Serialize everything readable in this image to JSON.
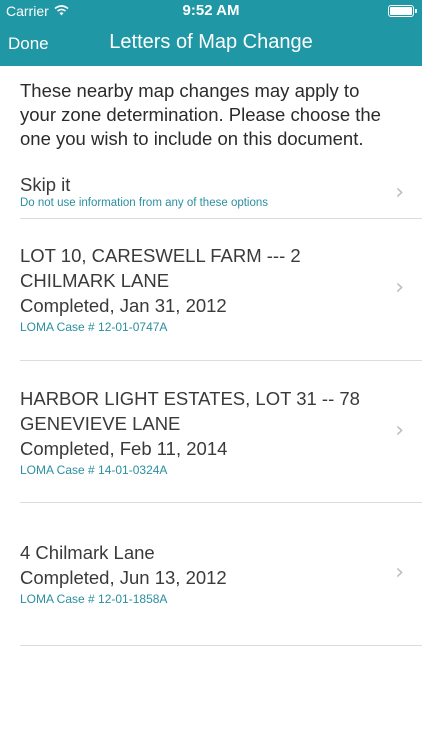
{
  "status_bar": {
    "carrier": "Carrier",
    "time": "9:52 AM",
    "battery_level": 1.0
  },
  "nav": {
    "done_label": "Done",
    "title": "Letters of Map Change"
  },
  "intro_text": "These nearby map changes may apply to your zone determination. Please choose the one you wish to include on this document.",
  "skip": {
    "title": "Skip it",
    "subtitle": "Do not use information from any of these options"
  },
  "items": [
    {
      "title": "LOT 10, CARESWELL FARM --- 2 CHILMARK LANE",
      "status": "Completed, Jan 31, 2012",
      "case": "LOMA Case # 12-01-0747A"
    },
    {
      "title": "HARBOR LIGHT ESTATES, LOT 31 -- 78 GENEVIEVE LANE",
      "status": "Completed, Feb 11, 2014",
      "case": "LOMA Case # 14-01-0324A"
    },
    {
      "title": "4 Chilmark Lane",
      "status": "Completed, Jun 13, 2012",
      "case": "LOMA Case # 12-01-1858A"
    }
  ],
  "colors": {
    "header": "#1f97a4",
    "accent_text": "#2b8fa0"
  },
  "icons": [
    "wifi-icon",
    "battery-icon",
    "chevron-right-icon"
  ]
}
